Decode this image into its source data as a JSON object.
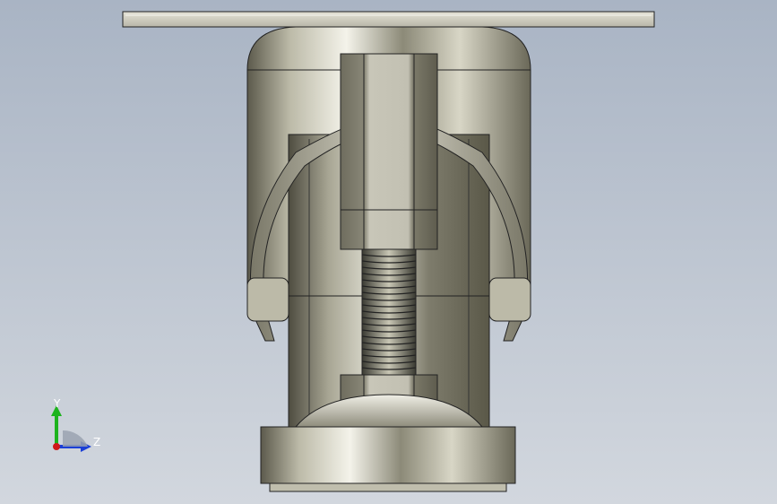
{
  "viewport": {
    "background_top": "#a9b4c4",
    "background_bottom": "#d2d7de"
  },
  "model": {
    "parts": [
      "top-plate",
      "swivel-housing",
      "yoke-arc",
      "hex-nut-upper",
      "threaded-stud",
      "hex-nut-lower",
      "wheel-hub",
      "wheel"
    ]
  },
  "triad": {
    "y_label": "Y",
    "z_label": "Z",
    "y_color": "#1db31d",
    "z_color": "#1a3fd6",
    "x_color": "#d01818"
  }
}
